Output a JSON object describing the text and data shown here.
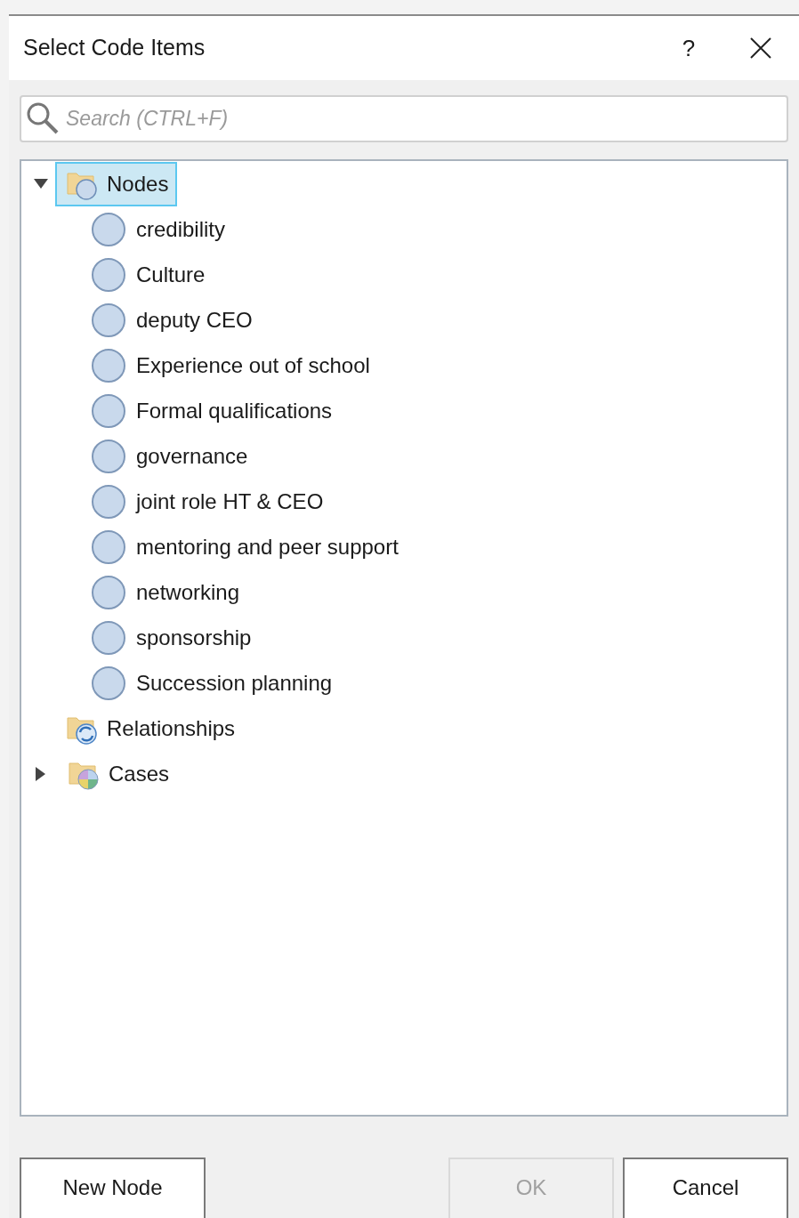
{
  "window": {
    "title": "Select Code Items",
    "help": "?"
  },
  "search": {
    "placeholder": "Search (CTRL+F)"
  },
  "tree": [
    {
      "kind": "nodes",
      "label": "Nodes",
      "selected": true,
      "expanded": true,
      "children": [
        {
          "kind": "node",
          "label": "credibility",
          "selected": false
        },
        {
          "kind": "node",
          "label": "Culture",
          "selected": false
        },
        {
          "kind": "node",
          "label": "deputy CEO",
          "selected": false
        },
        {
          "kind": "node",
          "label": "Experience out of school",
          "selected": false
        },
        {
          "kind": "node",
          "label": "Formal qualifications",
          "selected": false
        },
        {
          "kind": "node",
          "label": "governance",
          "selected": false
        },
        {
          "kind": "node",
          "label": "joint role HT & CEO",
          "selected": false
        },
        {
          "kind": "node",
          "label": "mentoring and peer support",
          "selected": false
        },
        {
          "kind": "node",
          "label": "networking",
          "selected": false
        },
        {
          "kind": "node",
          "label": "sponsorship",
          "selected": false
        },
        {
          "kind": "node",
          "label": "Succession planning",
          "selected": false
        }
      ]
    },
    {
      "kind": "relationships",
      "label": "Relationships",
      "selected": false
    },
    {
      "kind": "cases",
      "label": "Cases",
      "selected": false,
      "expanded": false
    }
  ],
  "buttons": [
    {
      "label": "New Node",
      "disabled": false
    },
    {
      "label": "OK",
      "disabled": true
    },
    {
      "label": "Cancel",
      "disabled": false
    }
  ]
}
